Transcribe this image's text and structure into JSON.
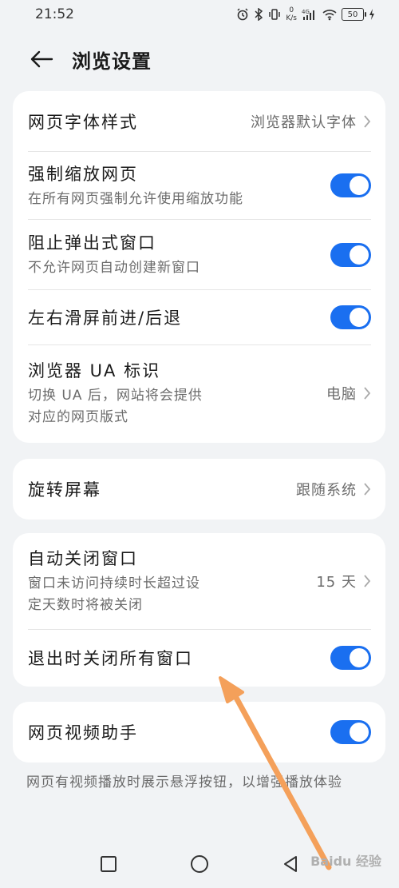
{
  "status_bar": {
    "time": "21:52",
    "net_speed_value": "0",
    "net_speed_unit": "K/s",
    "network": "4G",
    "battery": "50"
  },
  "header": {
    "title": "浏览设置"
  },
  "card1": {
    "rows": [
      {
        "title": "网页字体样式",
        "value": "浏览器默认字体"
      },
      {
        "title": "强制缩放网页",
        "subtitle": "在所有网页强制允许使用缩放功能",
        "toggle": true
      },
      {
        "title": "阻止弹出式窗口",
        "subtitle": "不允许网页自动创建新窗口",
        "toggle": true
      },
      {
        "title": "左右滑屏前进/后退",
        "toggle": true
      },
      {
        "title": "浏览器 UA 标识",
        "subtitle_line1": "切换 UA 后，网站将会提供",
        "subtitle_line2": "对应的网页版式",
        "value": "电脑"
      }
    ]
  },
  "card2": {
    "title": "旋转屏幕",
    "value": "跟随系统"
  },
  "card3": {
    "rows": [
      {
        "title": "自动关闭窗口",
        "subtitle_line1": "窗口未访问持续时长超过设",
        "subtitle_line2": "定天数时将被关闭",
        "value": "15 天"
      },
      {
        "title": "退出时关闭所有窗口",
        "toggle": true
      }
    ]
  },
  "card4": {
    "title": "网页视频助手",
    "toggle": true
  },
  "footnote": "网页有视频播放时展示悬浮按钮，以增强播放体验",
  "watermark": "Baidu 经验",
  "colors": {
    "accent": "#1a6ff0",
    "annotation_arrow": "#f4a05a",
    "background": "#f1f3f5"
  },
  "icons": [
    "back-arrow-icon",
    "chevron-right-icon",
    "bluetooth-icon",
    "vibrate-icon",
    "signal-icon",
    "wifi-icon",
    "battery-icon",
    "charging-icon"
  ]
}
